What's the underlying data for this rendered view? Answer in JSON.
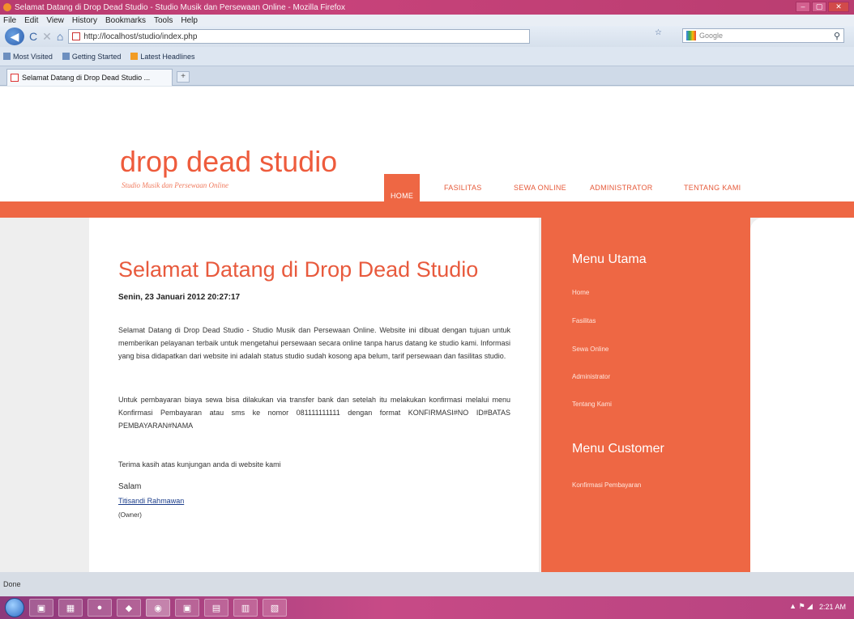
{
  "window": {
    "title": "Selamat Datang di Drop Dead Studio - Studio Musik dan Persewaan Online - Mozilla Firefox",
    "minimize": "–",
    "maximize": "▢",
    "close": "✕"
  },
  "menubar": [
    "File",
    "Edit",
    "View",
    "History",
    "Bookmarks",
    "Tools",
    "Help"
  ],
  "navbar": {
    "back": "◀",
    "reload": "C",
    "stop": "✕",
    "home": "⌂",
    "url": "http://localhost/studio/index.php",
    "star": "☆",
    "search_placeholder": "Google",
    "search_go": "⚲"
  },
  "bookmarks": [
    "Most Visited",
    "Getting Started",
    "Latest Headlines"
  ],
  "tab": {
    "label": "Selamat Datang di Drop Dead Studio ...",
    "new_tab": "+"
  },
  "site": {
    "logo": "drop dead studio",
    "tagline": "Studio Musik dan Persewaan Online",
    "nav": [
      "HOME",
      "FASILITAS",
      "SEWA ONLINE",
      "ADMINISTRATOR",
      "TENTANG KAMI"
    ]
  },
  "main": {
    "title": "Selamat Datang di Drop Dead Studio",
    "date": "Senin, 23 Januari 2012 20:27:17",
    "paragraphs": [
      "Selamat Datang di Drop Dead Studio - Studio Musik dan Persewaan Online. Website ini dibuat dengan tujuan untuk memberikan pelayanan terbaik untuk mengetahui persewaan secara online tanpa harus datang ke studio kami. Informasi yang bisa didapatkan dari website ini adalah status studio sudah kosong apa belum, tarif persewaan dan fasilitas studio.",
      "Untuk pembayaran biaya sewa bisa dilakukan via transfer bank dan setelah itu melakukan konfirmasi melalui menu Konfirmasi Pembayaran atau sms ke nomor 081111111111 dengan format KONFIRMASI#NO ID#BATAS PEMBAYARAN#NAMA",
      "Terima kasih atas kunjungan anda di website kami"
    ],
    "sign_salutation": "Salam",
    "sign_name": "Titisandi Rahmawan",
    "sign_role": "(Owner)"
  },
  "sidebar": {
    "heading1": "Menu Utama",
    "links": [
      "Home",
      "Fasilitas",
      "Sewa Online",
      "Administrator",
      "Tentang Kami"
    ],
    "heading2": "Menu Customer",
    "customer_links": [
      "Konfirmasi Pembayaran"
    ]
  },
  "status": "Done",
  "taskbar": {
    "buttons": [
      "▣",
      "▦",
      "●",
      "◆",
      "◉",
      "▣",
      "▤",
      "▥",
      "▧"
    ],
    "time": "2:21 AM",
    "tray": "▲ ⚑ ◢"
  }
}
